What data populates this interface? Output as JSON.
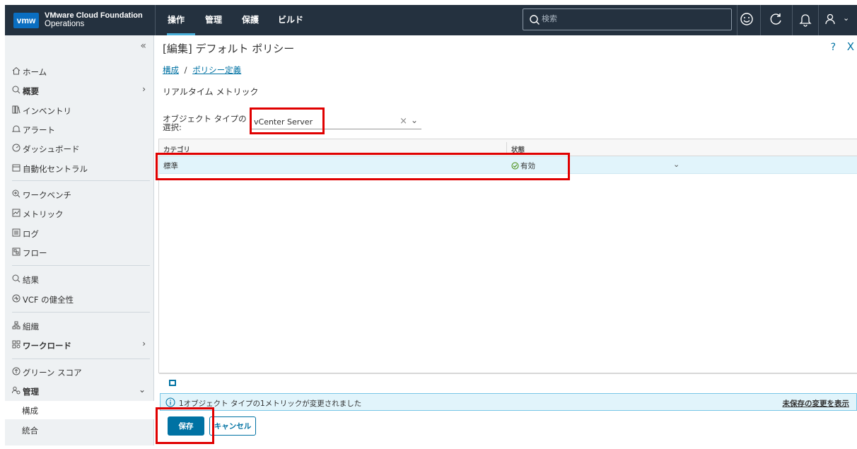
{
  "header": {
    "logo": "vmw",
    "product_name": "VMware Cloud Foundation",
    "product_sub": "Operations",
    "nav": [
      "操作",
      "管理",
      "保護",
      "ビルド"
    ],
    "search_placeholder": "検索"
  },
  "sidebar": {
    "collapse": "«",
    "items": [
      {
        "label": "ホーム",
        "icon": "home-icon"
      },
      {
        "label": "概要",
        "icon": "overview-icon",
        "bold": true,
        "chevron": "›"
      },
      {
        "label": "インベントリ",
        "icon": "inventory-icon"
      },
      {
        "label": "アラート",
        "icon": "alert-icon"
      },
      {
        "label": "ダッシュボード",
        "icon": "dashboard-icon"
      },
      {
        "label": "自動化セントラル",
        "icon": "automation-icon"
      },
      {
        "label": "ワークベンチ",
        "icon": "workbench-icon"
      },
      {
        "label": "メトリック",
        "icon": "metrics-icon"
      },
      {
        "label": "ログ",
        "icon": "logs-icon"
      },
      {
        "label": "フロー",
        "icon": "flow-icon"
      },
      {
        "label": "結果",
        "icon": "results-icon"
      },
      {
        "label": "VCF の健全性",
        "icon": "health-icon"
      },
      {
        "label": "組織",
        "icon": "organization-icon"
      },
      {
        "label": "ワークロード",
        "icon": "workload-icon",
        "bold": true,
        "chevron": "›"
      },
      {
        "label": "グリーン スコア",
        "icon": "green-score-icon"
      },
      {
        "label": "管理",
        "icon": "admin-icon",
        "bold": true,
        "chevron": "⌄"
      }
    ],
    "sub_items": [
      "構成",
      "統合"
    ]
  },
  "main": {
    "title": "[編集] デフォルト ポリシー",
    "help": "?",
    "close": "X",
    "breadcrumb": {
      "part1": "構成",
      "sep": "/",
      "part2": "ポリシー定義"
    },
    "section_title": "リアルタイム メトリック",
    "object_type_label": "オブジェクト タイプの選択:",
    "object_type_value": "vCenter Server",
    "grid": {
      "headers": [
        "カテゴリ",
        "状態"
      ],
      "rows": [
        {
          "category": "標準",
          "status": "有効"
        }
      ]
    },
    "info_message": "1オブジェクト タイプの1メトリックが変更されました",
    "info_link": "未保存の変更を表示",
    "save": "保存",
    "cancel": "キャンセル"
  },
  "colors": {
    "topbar": "#24313f",
    "accent": "#0072a3",
    "highlight": "#e00000"
  }
}
